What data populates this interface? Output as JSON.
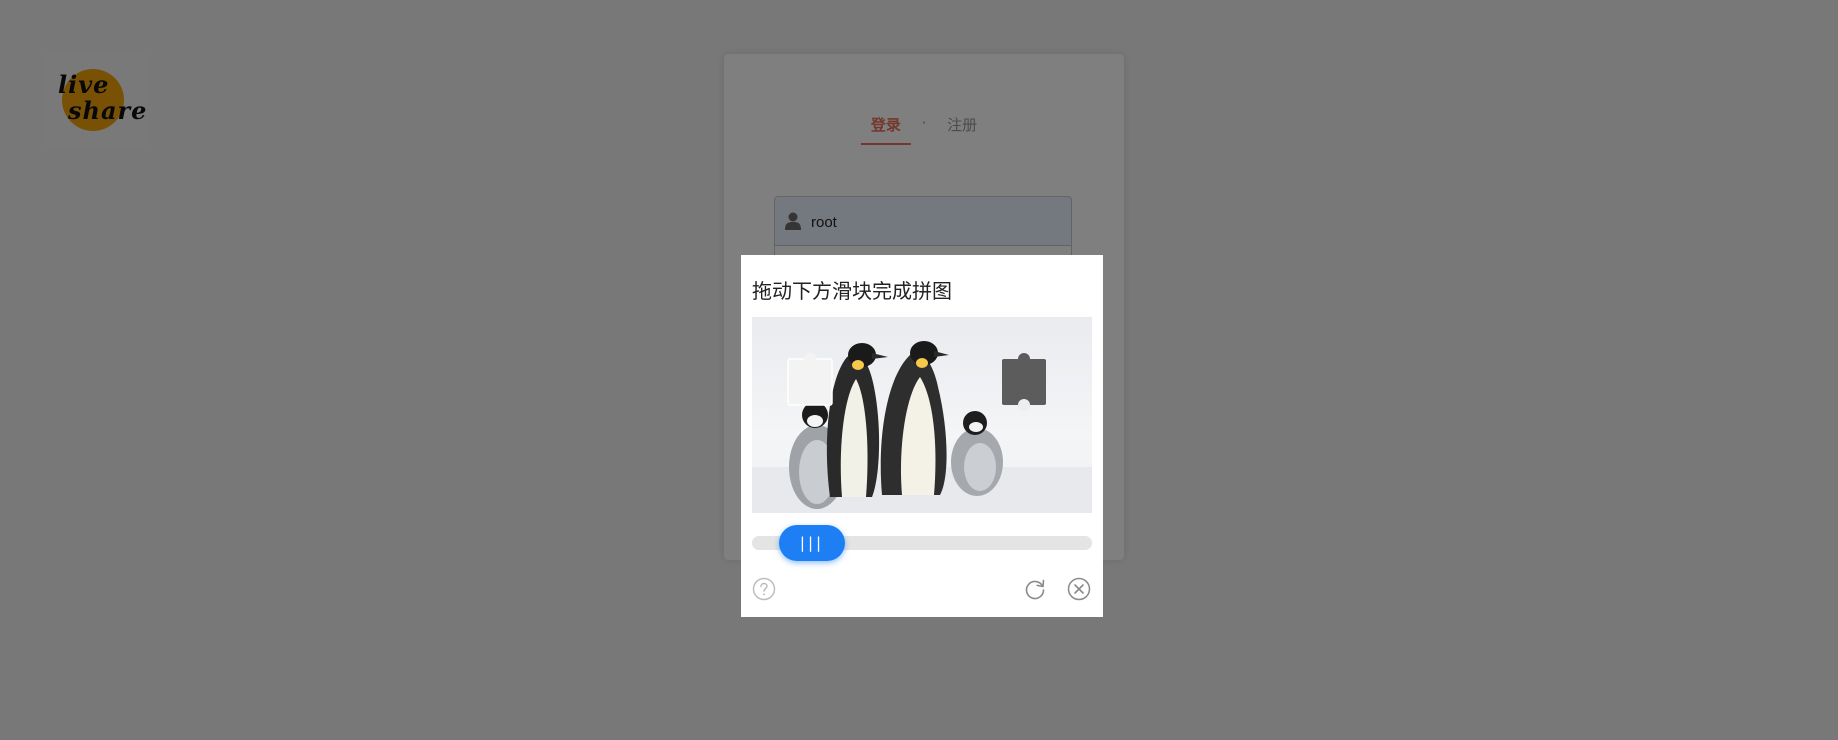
{
  "logo": {
    "line1": "live",
    "line2": "share"
  },
  "auth_tabs": {
    "login": "登录",
    "separator": "·",
    "register": "注册"
  },
  "form": {
    "username_value": "root"
  },
  "captcha": {
    "title": "拖动下方滑块完成拼图",
    "slider_handle_label": "|||",
    "slider_progress": 0.1,
    "image_subject": "penguins"
  },
  "icons": {
    "user": "user-icon",
    "help": "question-circle-icon",
    "refresh": "refresh-icon",
    "close": "close-circle-icon"
  },
  "colors": {
    "accent": "#ea6f5a",
    "slider": "#1e7ff5",
    "overlay": "rgba(0,0,0,0.5)"
  }
}
